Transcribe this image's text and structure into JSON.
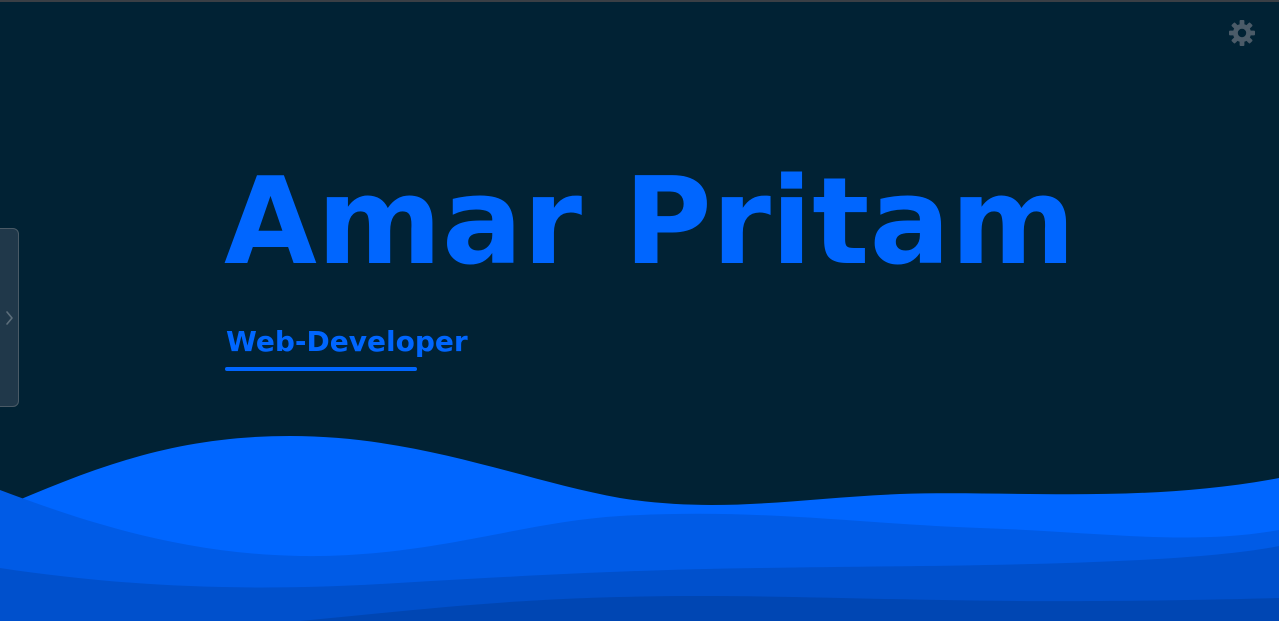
{
  "hero": {
    "name": "Amar Pritam",
    "role": "Web-Developer"
  },
  "icons": {
    "settings": "gear-icon",
    "side_tab": "chevron-right-icon"
  },
  "colors": {
    "background": "#012234",
    "accent": "#0066ff",
    "wave_light": "#0066ff",
    "wave_mid": "#005be6",
    "wave_dark": "#0050cc",
    "wave_deepest": "#0046b3",
    "icon": "#4b5b68"
  }
}
